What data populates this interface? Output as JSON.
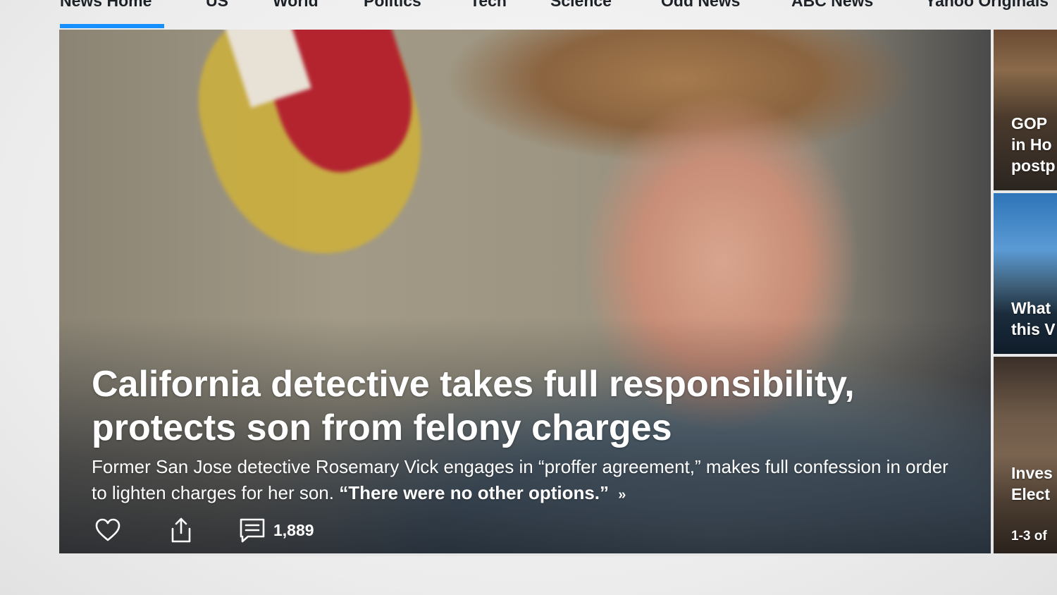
{
  "nav": {
    "items": [
      {
        "label": "News Home",
        "active": true
      },
      {
        "label": "US"
      },
      {
        "label": "World"
      },
      {
        "label": "Politics"
      },
      {
        "label": "Tech"
      },
      {
        "label": "Science"
      },
      {
        "label": "Odd News"
      },
      {
        "label": "ABC News"
      },
      {
        "label": "Yahoo Originals"
      }
    ],
    "accent_color": "#188fff"
  },
  "hero": {
    "title": "California detective takes full responsibility, protects son from felony charges",
    "summary": "Former San Jose detective Rosemary Vick engages in “proffer agreement,” makes full confession in order to lighten charges for her son.",
    "quote": "“There were no other options.”",
    "more_glyph": "»",
    "actions": {
      "like_icon": "heart-icon",
      "share_icon": "share-icon",
      "comment_icon": "comment-icon",
      "comment_count": "1,889"
    }
  },
  "rail": {
    "cards": [
      {
        "lines": [
          "GOP",
          "in Ho",
          "postp"
        ]
      },
      {
        "lines": [
          "What",
          "this V"
        ]
      },
      {
        "lines": [
          "Inves",
          "Elect"
        ]
      }
    ],
    "pager": "1-3 of"
  }
}
